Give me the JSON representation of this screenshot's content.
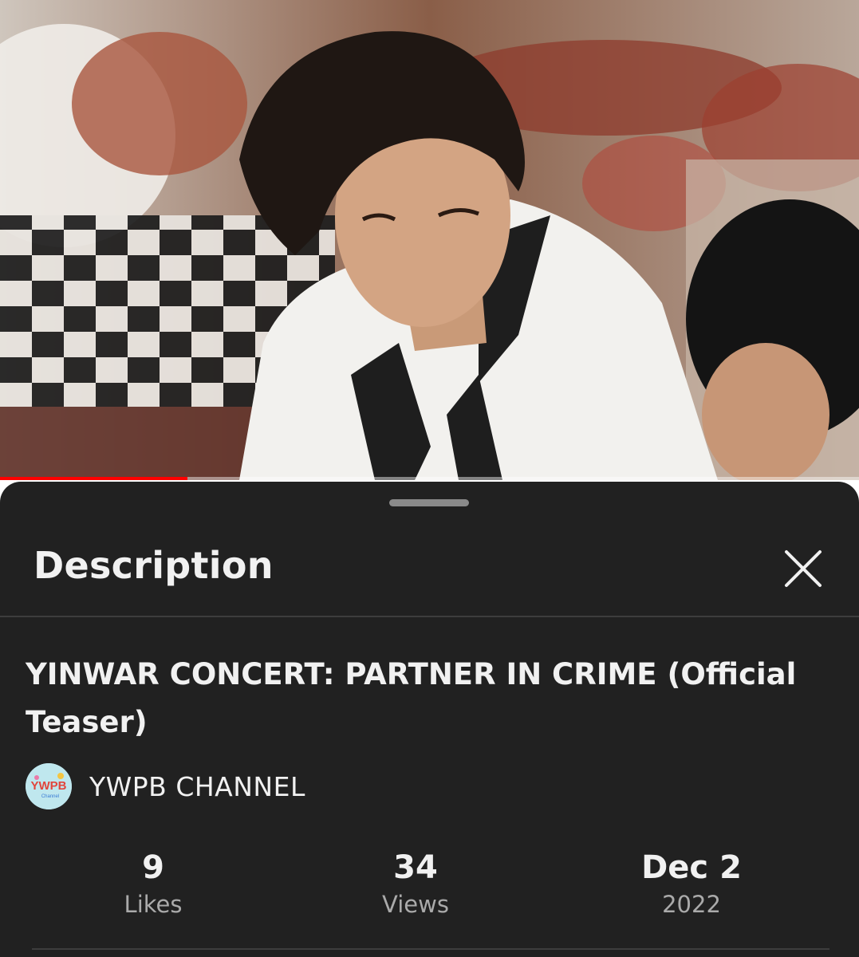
{
  "video": {
    "progress_fraction": 0.218
  },
  "sheet": {
    "title": "Description",
    "close_icon": "close-icon"
  },
  "details": {
    "video_title": "YINWAR CONCERT: PARTNER IN CRIME (Official Teaser)",
    "channel": {
      "name": "YWPB CHANNEL",
      "avatar_text": "YWPB",
      "avatar_subtext": "Channel"
    },
    "stats": {
      "likes": {
        "value": "9",
        "label": "Likes"
      },
      "views": {
        "value": "34",
        "label": "Views"
      },
      "date": {
        "value": "Dec 2",
        "label": "2022"
      }
    }
  },
  "colors": {
    "sheet_background": "#212121",
    "progress": "#ff0000",
    "text_primary": "#f1f1f1",
    "text_secondary": "#aaaaaa"
  }
}
